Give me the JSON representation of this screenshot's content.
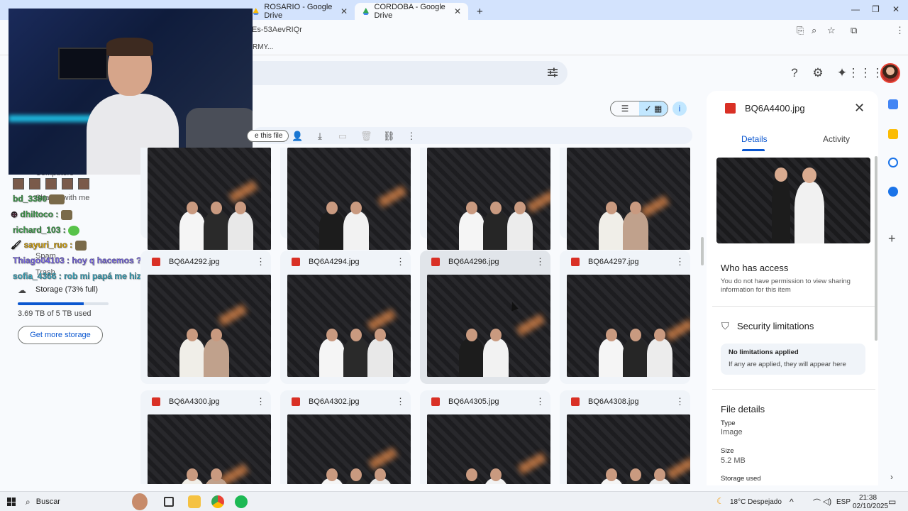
{
  "browser": {
    "tabs": [
      {
        "label": "ROSARIO - Google Drive"
      },
      {
        "label": "CORDOBA - Google Drive",
        "active": true
      }
    ],
    "new_tab": "+",
    "url": "Es-53AevRIQr",
    "bookmark": "RMY..."
  },
  "drive": {
    "sidebar": {
      "storage_label": "Storage (73% full)",
      "storage_fraction": 0.73,
      "used_text": "3.69 TB of 5 TB used",
      "get_more": "Get more storage",
      "spam": "Spam",
      "trash": "Trash",
      "computers": "Computers",
      "shared": "Shared with me"
    },
    "share_chip": "e this file",
    "files": [
      {
        "name": "BQ6A4292.jpg"
      },
      {
        "name": "BQ6A4294.jpg"
      },
      {
        "name": "BQ6A4296.jpg",
        "selected": true
      },
      {
        "name": "BQ6A4297.jpg"
      },
      {
        "name": "BQ6A4300.jpg"
      },
      {
        "name": "BQ6A4302.jpg"
      },
      {
        "name": "BQ6A4305.jpg"
      },
      {
        "name": "BQ6A4308.jpg"
      }
    ]
  },
  "details": {
    "file_name": "BQ6A4400.jpg",
    "tab_details": "Details",
    "tab_activity": "Activity",
    "who_has_access": "Who has access",
    "access_text": "You do not have permission to view sharing information for this item",
    "security_title": "Security limitations",
    "no_limits": "No limitations applied",
    "limits_hint": "If any are applied, they will appear here",
    "file_details": "File details",
    "type_label": "Type",
    "type_value": "Image",
    "size_label": "Size",
    "size_value": "5.2 MB",
    "storage_used": "Storage used"
  },
  "chat": [
    {
      "user": "dhiltoco",
      "sep": " :",
      "color": "#3fa34d"
    },
    {
      "user": "richard_103",
      "sep": " :",
      "color": "#3fa34d"
    },
    {
      "user": "sayuri_ruo",
      "sep": " :",
      "color": "#e0a800"
    },
    {
      "user": "Thiago04103",
      "sep": " : ",
      "msg": "hoy q hacemos ?",
      "color": "#7b68ee"
    },
    {
      "user": "sofia_4366",
      "sep": " : ",
      "msg": "rob mi papá me hizo pure con pollo",
      "color": "#3ab0c9"
    }
  ],
  "chat_extra": "bd_3390",
  "taskbar": {
    "search": "Buscar",
    "weather": "18°C Despejado",
    "lang": "ESP",
    "time": "21:38",
    "date": "02/10/2025"
  },
  "colors": {
    "accent": "#0b57d0",
    "selected": "#c2e7ff",
    "image_red": "#d93025"
  }
}
